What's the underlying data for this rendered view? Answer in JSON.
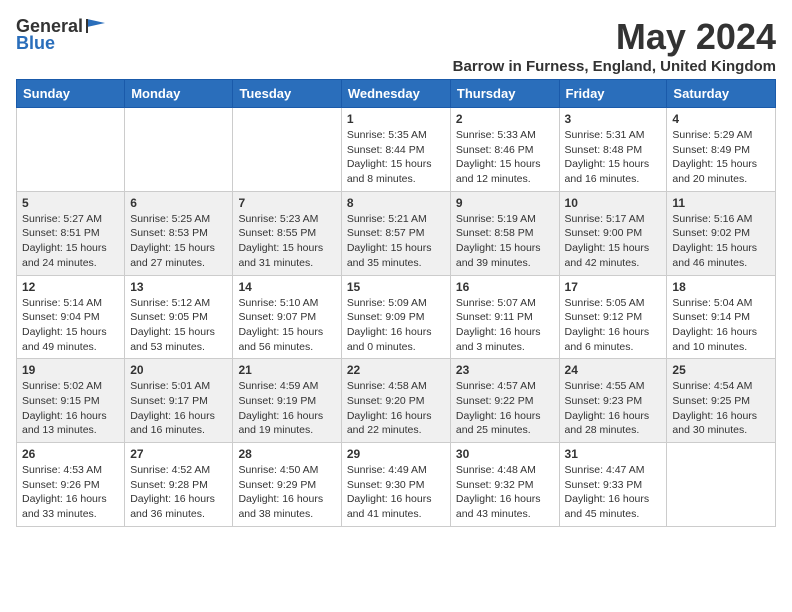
{
  "logo": {
    "general": "General",
    "blue": "Blue"
  },
  "title": "May 2024",
  "subtitle": "Barrow in Furness, England, United Kingdom",
  "days_of_week": [
    "Sunday",
    "Monday",
    "Tuesday",
    "Wednesday",
    "Thursday",
    "Friday",
    "Saturday"
  ],
  "weeks": [
    [
      {
        "day": "",
        "info": ""
      },
      {
        "day": "",
        "info": ""
      },
      {
        "day": "",
        "info": ""
      },
      {
        "day": "1",
        "info": "Sunrise: 5:35 AM\nSunset: 8:44 PM\nDaylight: 15 hours\nand 8 minutes."
      },
      {
        "day": "2",
        "info": "Sunrise: 5:33 AM\nSunset: 8:46 PM\nDaylight: 15 hours\nand 12 minutes."
      },
      {
        "day": "3",
        "info": "Sunrise: 5:31 AM\nSunset: 8:48 PM\nDaylight: 15 hours\nand 16 minutes."
      },
      {
        "day": "4",
        "info": "Sunrise: 5:29 AM\nSunset: 8:49 PM\nDaylight: 15 hours\nand 20 minutes."
      }
    ],
    [
      {
        "day": "5",
        "info": "Sunrise: 5:27 AM\nSunset: 8:51 PM\nDaylight: 15 hours\nand 24 minutes."
      },
      {
        "day": "6",
        "info": "Sunrise: 5:25 AM\nSunset: 8:53 PM\nDaylight: 15 hours\nand 27 minutes."
      },
      {
        "day": "7",
        "info": "Sunrise: 5:23 AM\nSunset: 8:55 PM\nDaylight: 15 hours\nand 31 minutes."
      },
      {
        "day": "8",
        "info": "Sunrise: 5:21 AM\nSunset: 8:57 PM\nDaylight: 15 hours\nand 35 minutes."
      },
      {
        "day": "9",
        "info": "Sunrise: 5:19 AM\nSunset: 8:58 PM\nDaylight: 15 hours\nand 39 minutes."
      },
      {
        "day": "10",
        "info": "Sunrise: 5:17 AM\nSunset: 9:00 PM\nDaylight: 15 hours\nand 42 minutes."
      },
      {
        "day": "11",
        "info": "Sunrise: 5:16 AM\nSunset: 9:02 PM\nDaylight: 15 hours\nand 46 minutes."
      }
    ],
    [
      {
        "day": "12",
        "info": "Sunrise: 5:14 AM\nSunset: 9:04 PM\nDaylight: 15 hours\nand 49 minutes."
      },
      {
        "day": "13",
        "info": "Sunrise: 5:12 AM\nSunset: 9:05 PM\nDaylight: 15 hours\nand 53 minutes."
      },
      {
        "day": "14",
        "info": "Sunrise: 5:10 AM\nSunset: 9:07 PM\nDaylight: 15 hours\nand 56 minutes."
      },
      {
        "day": "15",
        "info": "Sunrise: 5:09 AM\nSunset: 9:09 PM\nDaylight: 16 hours\nand 0 minutes."
      },
      {
        "day": "16",
        "info": "Sunrise: 5:07 AM\nSunset: 9:11 PM\nDaylight: 16 hours\nand 3 minutes."
      },
      {
        "day": "17",
        "info": "Sunrise: 5:05 AM\nSunset: 9:12 PM\nDaylight: 16 hours\nand 6 minutes."
      },
      {
        "day": "18",
        "info": "Sunrise: 5:04 AM\nSunset: 9:14 PM\nDaylight: 16 hours\nand 10 minutes."
      }
    ],
    [
      {
        "day": "19",
        "info": "Sunrise: 5:02 AM\nSunset: 9:15 PM\nDaylight: 16 hours\nand 13 minutes."
      },
      {
        "day": "20",
        "info": "Sunrise: 5:01 AM\nSunset: 9:17 PM\nDaylight: 16 hours\nand 16 minutes."
      },
      {
        "day": "21",
        "info": "Sunrise: 4:59 AM\nSunset: 9:19 PM\nDaylight: 16 hours\nand 19 minutes."
      },
      {
        "day": "22",
        "info": "Sunrise: 4:58 AM\nSunset: 9:20 PM\nDaylight: 16 hours\nand 22 minutes."
      },
      {
        "day": "23",
        "info": "Sunrise: 4:57 AM\nSunset: 9:22 PM\nDaylight: 16 hours\nand 25 minutes."
      },
      {
        "day": "24",
        "info": "Sunrise: 4:55 AM\nSunset: 9:23 PM\nDaylight: 16 hours\nand 28 minutes."
      },
      {
        "day": "25",
        "info": "Sunrise: 4:54 AM\nSunset: 9:25 PM\nDaylight: 16 hours\nand 30 minutes."
      }
    ],
    [
      {
        "day": "26",
        "info": "Sunrise: 4:53 AM\nSunset: 9:26 PM\nDaylight: 16 hours\nand 33 minutes."
      },
      {
        "day": "27",
        "info": "Sunrise: 4:52 AM\nSunset: 9:28 PM\nDaylight: 16 hours\nand 36 minutes."
      },
      {
        "day": "28",
        "info": "Sunrise: 4:50 AM\nSunset: 9:29 PM\nDaylight: 16 hours\nand 38 minutes."
      },
      {
        "day": "29",
        "info": "Sunrise: 4:49 AM\nSunset: 9:30 PM\nDaylight: 16 hours\nand 41 minutes."
      },
      {
        "day": "30",
        "info": "Sunrise: 4:48 AM\nSunset: 9:32 PM\nDaylight: 16 hours\nand 43 minutes."
      },
      {
        "day": "31",
        "info": "Sunrise: 4:47 AM\nSunset: 9:33 PM\nDaylight: 16 hours\nand 45 minutes."
      },
      {
        "day": "",
        "info": ""
      }
    ]
  ]
}
